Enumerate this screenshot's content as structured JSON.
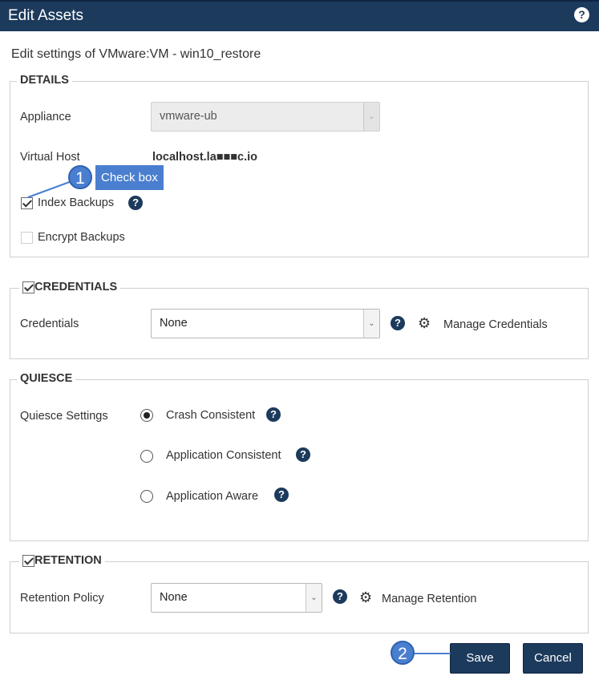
{
  "dialog": {
    "title": "Edit Assets",
    "help_symbol": "?",
    "subtitle": "Edit settings of VMware:VM - win10_restore"
  },
  "details": {
    "legend": "DETAILS",
    "appliance_label": "Appliance",
    "appliance_value": "vmware-ub",
    "virtual_host_label": "Virtual Host",
    "virtual_host_value": "localhost.la■■■c.io",
    "index_backups_label": "Index Backups",
    "index_backups_checked": true,
    "encrypt_backups_label": "Encrypt Backups",
    "encrypt_backups_checked": false
  },
  "credentials": {
    "legend": "CREDENTIALS",
    "label": "Credentials",
    "value": "None",
    "manage_label": "Manage Credentials"
  },
  "quiesce": {
    "legend": "QUIESCE",
    "label": "Quiesce Settings",
    "options": [
      {
        "label": "Crash Consistent",
        "selected": true
      },
      {
        "label": "Application Consistent",
        "selected": false
      },
      {
        "label": "Application Aware",
        "selected": false
      }
    ]
  },
  "retention": {
    "legend": "RETENTION",
    "label": "Retention Policy",
    "value": "None",
    "manage_label": "Manage Retention"
  },
  "buttons": {
    "save": "Save",
    "cancel": "Cancel"
  },
  "annotations": {
    "callout1_number": "1",
    "callout1_text": "Check box",
    "callout2_number": "2"
  },
  "icons": {
    "help": "help-circle-icon",
    "gear": "gears-icon",
    "dropdown": "chevron-down-icon"
  },
  "colors": {
    "header": "#1c3a5c",
    "callout": "#4a7fd0"
  }
}
